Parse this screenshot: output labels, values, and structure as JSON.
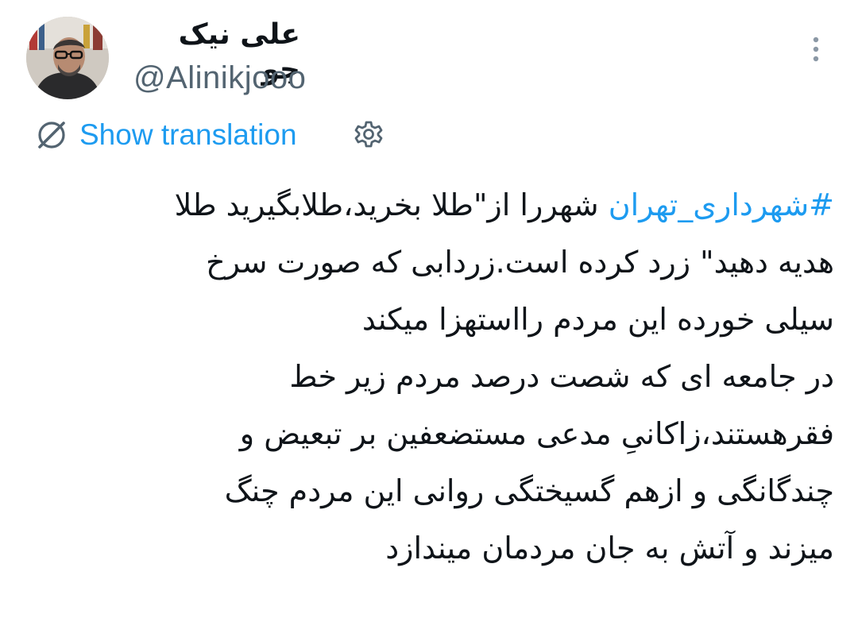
{
  "tweet": {
    "author": {
      "display_name": "علی نیک جو",
      "handle": "@Alinikjooo",
      "avatar_icon": "profile-photo"
    },
    "more_icon": "more-vertical-icon",
    "translation": {
      "icon": "translate-icon",
      "label": "Show translation",
      "settings_icon": "gear-icon"
    },
    "body": {
      "hashtag": "#شهرداری_تهران",
      "line1_rest": " شهررا از\"طلا بخرید،طلابگیرید طلا",
      "lines": [
        "هدیه دهید\" زرد کرده است.زردابی که صورت سرخ",
        "سیلی خورده این مردم رااستهزا میکند",
        "در جامعه ای که شصت درصد مردم زیر خط",
        "فقرهستند،زاکانیِ مدعی مستضعفین بر تبعیض و",
        "چندگانگی و ازهم گسیختگی روانی این مردم چنگ",
        "میزند و آتش به جان مردمان میندازد"
      ]
    },
    "colors": {
      "link": "#1d9bf0",
      "text": "#0f1419",
      "secondary": "#536471"
    }
  }
}
